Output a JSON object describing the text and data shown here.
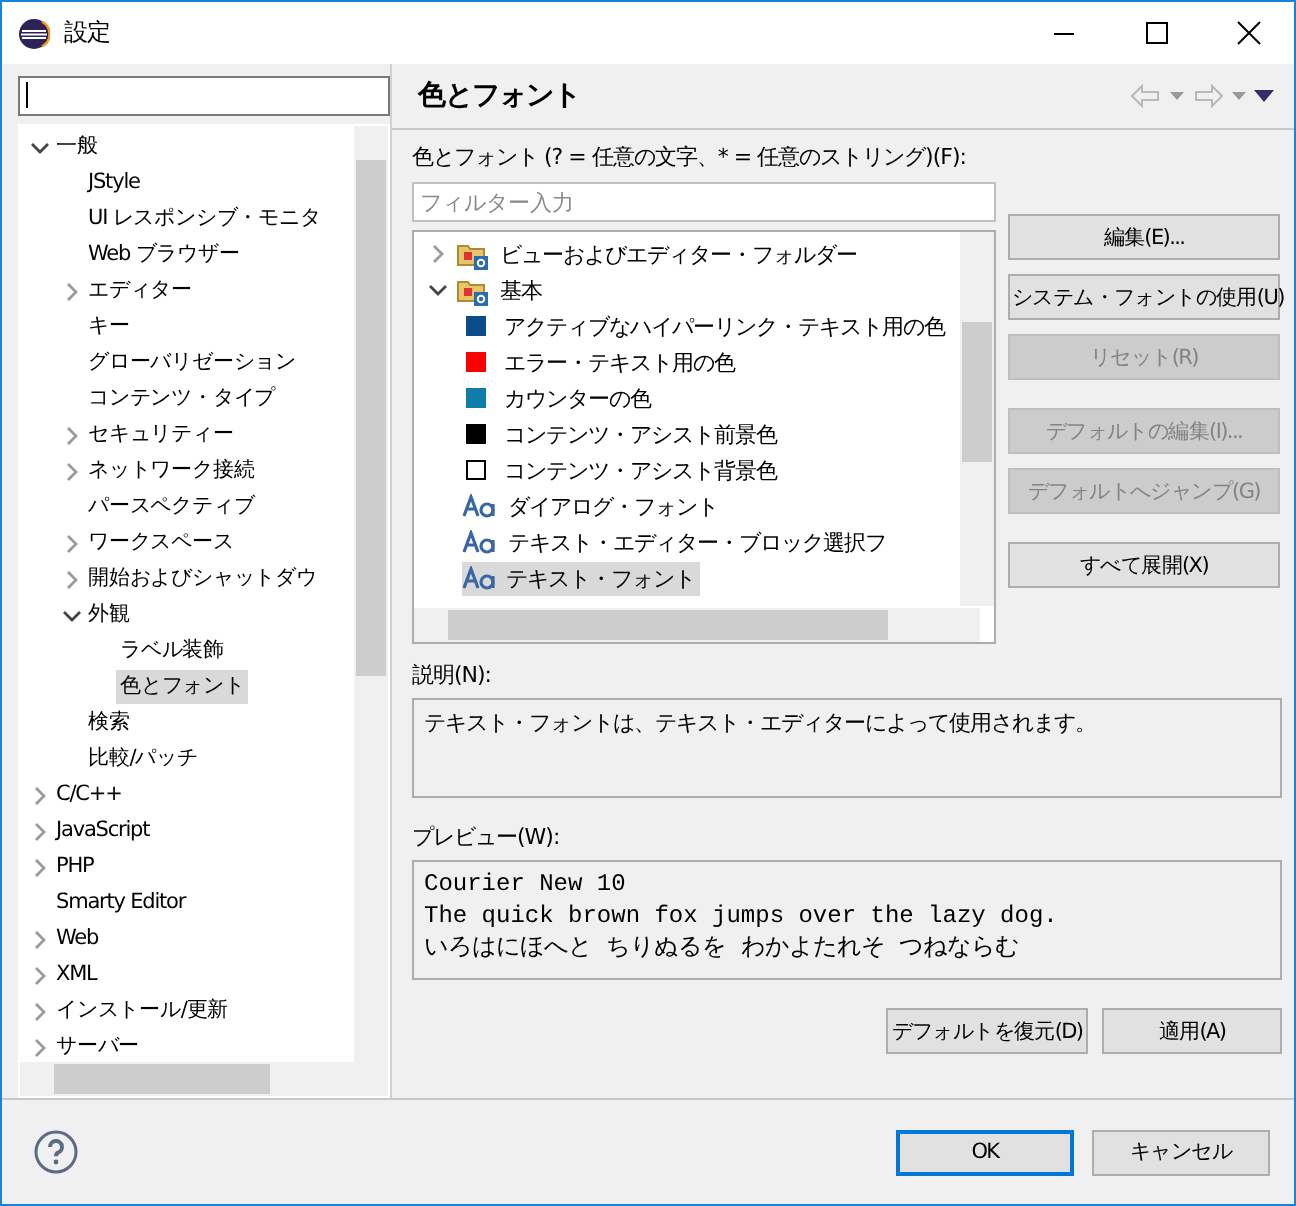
{
  "window": {
    "title": "設定"
  },
  "nav_tree": [
    {
      "label": "一般",
      "expanded": true,
      "selected": false,
      "children": [
        {
          "label": "JStyle",
          "selected": false
        },
        {
          "label": "UI レスポンシブ・モニタ",
          "selected": false
        },
        {
          "label": "Web ブラウザー",
          "selected": false
        },
        {
          "label": "エディター",
          "expanded": false,
          "selected": false
        },
        {
          "label": "キー",
          "selected": false
        },
        {
          "label": "グローバリゼーション",
          "selected": false
        },
        {
          "label": "コンテンツ・タイプ",
          "selected": false
        },
        {
          "label": "セキュリティー",
          "expanded": false,
          "selected": false
        },
        {
          "label": "ネットワーク接続",
          "expanded": false,
          "selected": false
        },
        {
          "label": "パースペクティブ",
          "selected": false
        },
        {
          "label": "ワークスペース",
          "expanded": false,
          "selected": false
        },
        {
          "label": "開始およびシャットダウ",
          "expanded": false,
          "selected": false
        },
        {
          "label": "外観",
          "expanded": true,
          "selected": false,
          "children": [
            {
              "label": "ラベル装飾",
              "selected": false
            },
            {
              "label": "色とフォント",
              "selected": true
            }
          ]
        },
        {
          "label": "検索",
          "selected": false
        },
        {
          "label": "比較/パッチ",
          "selected": false
        }
      ]
    },
    {
      "label": "C/C++",
      "expanded": false,
      "selected": false
    },
    {
      "label": "JavaScript",
      "expanded": false,
      "selected": false
    },
    {
      "label": "PHP",
      "expanded": false,
      "selected": false
    },
    {
      "label": "Smarty Editor",
      "selected": false
    },
    {
      "label": "Web",
      "expanded": false,
      "selected": false
    },
    {
      "label": "XML",
      "expanded": false,
      "selected": false
    },
    {
      "label": "インストール/更新",
      "expanded": false,
      "selected": false
    },
    {
      "label": "サーバー",
      "expanded": false,
      "selected": false
    }
  ],
  "page": {
    "title": "色とフォント",
    "colors_fonts": {
      "label": "色とフォント (? = 任意の文字、* = 任意のストリング)(F):",
      "filter": {
        "placeholder": "フィルター入力"
      },
      "tree": [
        {
          "label": "ビューおよびエディター・フォルダー",
          "kind": "folder",
          "expanded": false,
          "selected": false
        },
        {
          "label": "基本",
          "kind": "folder",
          "expanded": true,
          "selected": false,
          "children": [
            {
              "label": "アクティブなハイパーリンク・テキスト用の色",
              "kind": "color",
              "color": "#0b4a8b",
              "selected": false
            },
            {
              "label": "エラー・テキスト用の色",
              "kind": "color",
              "color": "#ff0000",
              "selected": false
            },
            {
              "label": "カウンターの色",
              "kind": "color",
              "color": "#0e7ea8",
              "selected": false
            },
            {
              "label": "コンテンツ・アシスト前景色",
              "kind": "color",
              "color": "#000000",
              "selected": false
            },
            {
              "label": "コンテンツ・アシスト背景色",
              "kind": "color",
              "color": "#ffffff",
              "selected": false
            },
            {
              "label": "ダイアログ・フォント",
              "kind": "font",
              "selected": false
            },
            {
              "label": "テキスト・エディター・ブロック選択フ",
              "kind": "font",
              "selected": false
            },
            {
              "label": "テキスト・フォント",
              "kind": "font",
              "selected": true
            }
          ]
        }
      ],
      "button_groups": [
        [
          {
            "label": "編集(E)...",
            "disabled": false
          },
          {
            "label": "システム・フォントの使用(U)",
            "disabled": false
          },
          {
            "label": "リセット(R)",
            "disabled": true
          }
        ],
        [
          {
            "label": "デフォルトの編集(I)...",
            "disabled": true
          },
          {
            "label": "デフォルトへジャンプ(G)",
            "disabled": true
          }
        ],
        [
          {
            "label": "すべて展開(X)",
            "disabled": false
          }
        ]
      ]
    },
    "description": {
      "label": "説明(N):",
      "text": "テキスト・フォントは、テキスト・エディターによって使用されます。"
    },
    "preview": {
      "label": "プレビュー(W):",
      "lines": [
        "Courier New 10",
        "The quick brown fox jumps over the lazy dog.",
        "いろはにほへと ちりぬるを わかよたれそ つねならむ"
      ]
    },
    "buttons": [
      {
        "label": "デフォルトを復元(D)",
        "default": false
      },
      {
        "label": "適用(A)",
        "default": false
      }
    ]
  },
  "dialog_buttons": [
    {
      "label": "OK",
      "default": true
    },
    {
      "label": "キャンセル",
      "default": false
    }
  ]
}
